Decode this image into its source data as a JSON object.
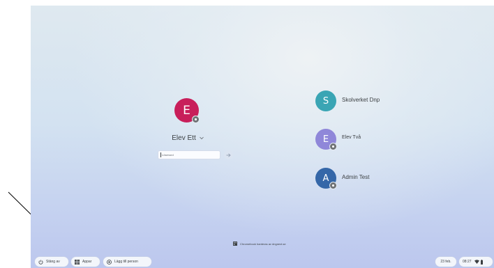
{
  "colors": {
    "avatar_main": "#c81e5a",
    "avatar_skolverket": "#3aa5b4",
    "avatar_elev_tva": "#8f87d9",
    "avatar_admin": "#3567a8"
  },
  "main_user": {
    "initial": "E",
    "name": "Elev Ett",
    "password_placeholder": "Lösenord"
  },
  "other_users": [
    {
      "initial": "S",
      "name": "Skolverket Dnp"
    },
    {
      "initial": "E",
      "name": "Elev Två"
    },
    {
      "initial": "A",
      "name": "Admin Test"
    }
  ],
  "managed_notice": "Chromebook hanteras av dngnext.se",
  "shelf": {
    "shutdown_label": "Stäng av",
    "apps_label": "Appar",
    "add_person_label": "Lägg till person",
    "date": "23 feb.",
    "time": "08:27"
  },
  "icons": [
    "power-icon",
    "apps-icon",
    "add-person-icon",
    "managed-building-icon",
    "chevron-down-icon",
    "arrow-right-icon",
    "wifi-icon",
    "battery-icon"
  ]
}
